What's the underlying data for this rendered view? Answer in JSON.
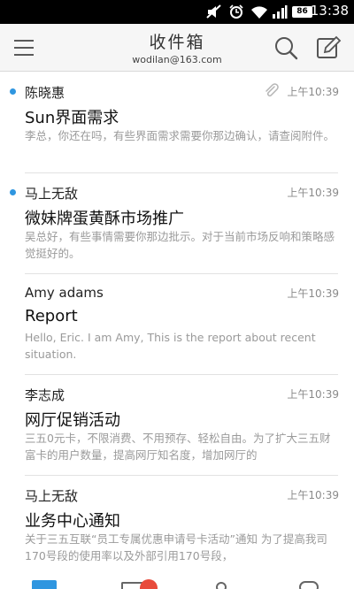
{
  "status_bar": {
    "time": "13:38",
    "battery": "86",
    "icons": [
      "mute-icon",
      "alarm-icon",
      "wifi-icon",
      "signal-icon",
      "battery-icon"
    ]
  },
  "header": {
    "title": "收件箱",
    "account": "wodilan@163.com",
    "icons": [
      "menu-icon",
      "search-icon",
      "compose-icon"
    ]
  },
  "mails": [
    {
      "sender": "陈晓惠",
      "time": "上午10:39",
      "subject": "Sun界面需求",
      "preview": "李总，你还在吗，有些界面需求需要你那边确认，请查阅附件。",
      "unread": true,
      "attachment": true
    },
    {
      "sender": "马上无敌",
      "time": "上午10:39",
      "subject": "微妹牌蛋黄酥市场推广",
      "preview": "吴总好，有些事情需要你那边批示。对于当前市场反响和策略感觉挺好的。",
      "unread": true,
      "attachment": false
    },
    {
      "sender": "Amy adams",
      "time": "上午10:39",
      "subject": "Report",
      "preview": "Hello, Eric. I am Amy, This is the report about recent situation.",
      "unread": false,
      "attachment": false
    },
    {
      "sender": "李志成",
      "time": "上午10:39",
      "subject": "网厅促销活动",
      "preview": "三五0元卡，不限消费、不用预存、轻松自由。为了扩大三五财富卡的用户数量，提高网厅知名度，增加网厅的",
      "unread": false,
      "attachment": false
    },
    {
      "sender": "马上无敌",
      "time": "上午10:39",
      "subject": "业务中心通知",
      "preview": "关于三五互联“员工专属优惠申请号卡活动”通知 为了提高我司170号段的使用率以及外部引用170号段，",
      "unread": false,
      "attachment": false
    }
  ],
  "colors": {
    "unread_dot": "#2f96e0",
    "tab_active": "#2f96e0",
    "badge": "#e84b3c"
  }
}
